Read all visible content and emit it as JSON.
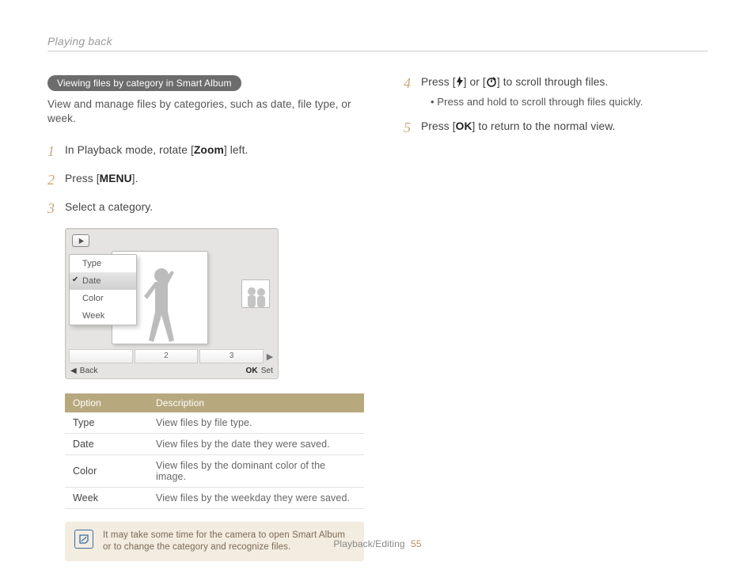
{
  "header": {
    "title": "Playing back"
  },
  "left": {
    "pill": "Viewing files by category in Smart Album",
    "intro": "View and manage files by categories, such as date, file type, or week.",
    "steps": [
      {
        "num": "1",
        "pre": "In Playback mode, rotate [",
        "b": "Zoom",
        "post": "] left."
      },
      {
        "num": "2",
        "pre": "Press [",
        "b": "MENU",
        "post": "]."
      },
      {
        "num": "3",
        "pre": "Select a category.",
        "b": "",
        "post": ""
      }
    ],
    "mock": {
      "dropdown": [
        "Type",
        "Date",
        "Color",
        "Week"
      ],
      "selected_index": 1,
      "strip_nums": [
        "2",
        "3"
      ],
      "foot_left_tri": "◀",
      "foot_left": "Back",
      "foot_right_b": "OK",
      "foot_right": "Set"
    },
    "table": {
      "headers": [
        "Option",
        "Description"
      ],
      "rows": [
        {
          "opt": "Type",
          "desc": "View files by file type."
        },
        {
          "opt": "Date",
          "desc": "View files by the date they were saved."
        },
        {
          "opt": "Color",
          "desc": "View files by the dominant color of the image."
        },
        {
          "opt": "Week",
          "desc": "View files by the weekday they were saved."
        }
      ]
    },
    "note": "It may take some time for the camera to open Smart Album or to change the category and recognize files."
  },
  "right": {
    "step4": {
      "num": "4",
      "pre": "Press [",
      "mid": "] or [",
      "post": "] to scroll through files."
    },
    "step4_bullet": "Press and hold to scroll through files quickly.",
    "step5": {
      "num": "5",
      "pre": "Press [",
      "b": "OK",
      "post": "] to return to the normal view."
    }
  },
  "footer": {
    "section": "Playback/Editing",
    "page": "55"
  }
}
